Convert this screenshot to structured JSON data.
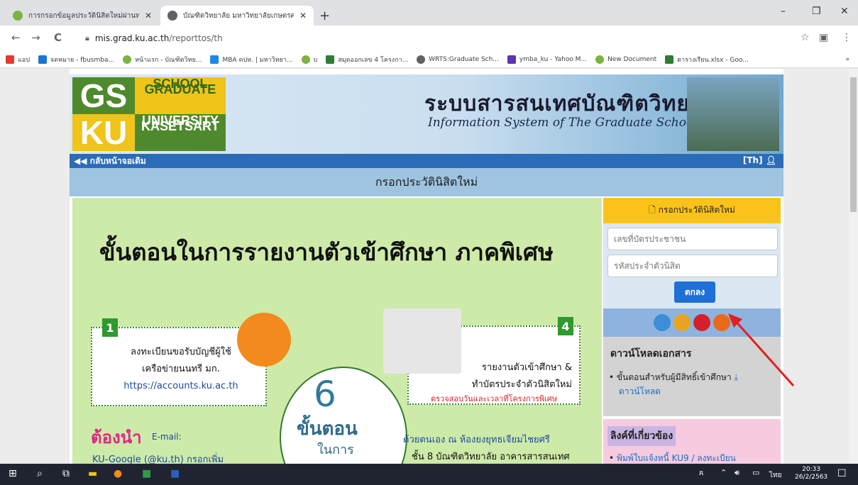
{
  "browser": {
    "tabs": [
      {
        "label": "การกรอกข้อมูลประวัตินิสิตใหม่ผ่านทาง",
        "active": false,
        "favicon_color": "#7cb342"
      },
      {
        "label": "บัณฑิตวิทยาลัย มหาวิทยาลัยเกษตรศาสต",
        "active": true,
        "favicon_color": "#5f6368"
      }
    ],
    "new_tab": "+",
    "window_controls": {
      "minimize": "–",
      "restore": "❐",
      "close": "✕"
    },
    "nav": {
      "back": "←",
      "forward": "→",
      "reload": "C"
    },
    "url_host": "mis.grad.ku.ac.th",
    "url_path": "/reporttos/th",
    "bookmarks": [
      {
        "label": "แอป",
        "color": "#e53935"
      },
      {
        "label": "จดหมาย - fbusmba...",
        "color": "#1976d2"
      },
      {
        "label": "หน้าแรก - บัณฑิตวิทย...",
        "color": "#7cb342"
      },
      {
        "label": "MBA คปห. | มหาวิทยา...",
        "color": "#1e88e5"
      },
      {
        "label": "บ",
        "color": "#7cb342"
      },
      {
        "label": "สมุดออกเลข 4 โครงกา...",
        "color": "#2e7d32"
      },
      {
        "label": "WRTS:Graduate Sch...",
        "color": "#5f6368"
      },
      {
        "label": "ymba_ku - Yahoo M...",
        "color": "#5e35b1"
      },
      {
        "label": "New Document",
        "color": "#7cb342"
      },
      {
        "label": "ตารางเรียน.xlsx - Goo...",
        "color": "#2e7d32"
      }
    ],
    "bookmarks_more": "»"
  },
  "site": {
    "logo": {
      "gs": "GS",
      "graduate": "GRADUATE",
      "school": "SCHOOL",
      "ku": "KU",
      "kasetsart": "KASETSART",
      "university": "UNIVERSITY"
    },
    "title_th": "ระบบสารสนเทศบัณฑิตวิทยาลัย",
    "title_en": "Information System of The Graduate School",
    "back_link": "◀◀ กลับหน้าจอเดิม",
    "lang": "[Th]",
    "page_heading": "กรอกประวัตินิสิตใหม่",
    "poster": {
      "title": "ขั้นตอนในการรายงานตัวเข้าศึกษา ภาคพิเศษ",
      "step1_num": "1",
      "step1_line1": "ลงทะเบียนขอรับบัญชีผู้ใช้",
      "step1_line2": "เครือข่ายนนทรี มก.",
      "step1_url": "https://accounts.ku.ac.th",
      "step4_num": "4",
      "step4_line1": "รายงานตัวเข้าศึกษา &",
      "step4_line2": "ทำบัตรประจำตัวนิสิตใหม่",
      "step4_note": "ตรวจสอบวันและเวลาที่โครงการพิเศษ",
      "must": "ต้องนำ",
      "email_label": "E-mail:",
      "google": "KU-Google (@ku.th) กรอกเพิ่ม",
      "six": "6",
      "steps": "ขั้นตอน",
      "in_process": "ในการ",
      "self_line1": "ด้วยตนเอง ณ ห้องยงยุทธเจียมไชยศรี",
      "self_line2": "ชั้น 8 บัณฑิตวิทยาลัย อาคารสารสนเทศ"
    },
    "form": {
      "heading": "🗋 กรอกประวัตินิสิตใหม่",
      "id_placeholder": "เลขที่บัตรประชาชน",
      "student_placeholder": "รหัสประจำตัวนิสิต",
      "submit": "ตกลง"
    },
    "downloads": {
      "heading": "ดาวน์โหลดเอกสาร",
      "item": "ขั้นตอนสำหรับผู้มีสิทธิ์เข้าศึกษา",
      "link": "ดาวน์โหลด"
    },
    "links": {
      "heading": "ลิงค์ที่เกี่ยวข้อง",
      "item": "พิมพ์ใบแจ้งหนี้ KU9 / ลงทะเบียน"
    }
  },
  "taskbar": {
    "lang": "ไทย",
    "time": "20:33",
    "date": "26/2/2563"
  }
}
